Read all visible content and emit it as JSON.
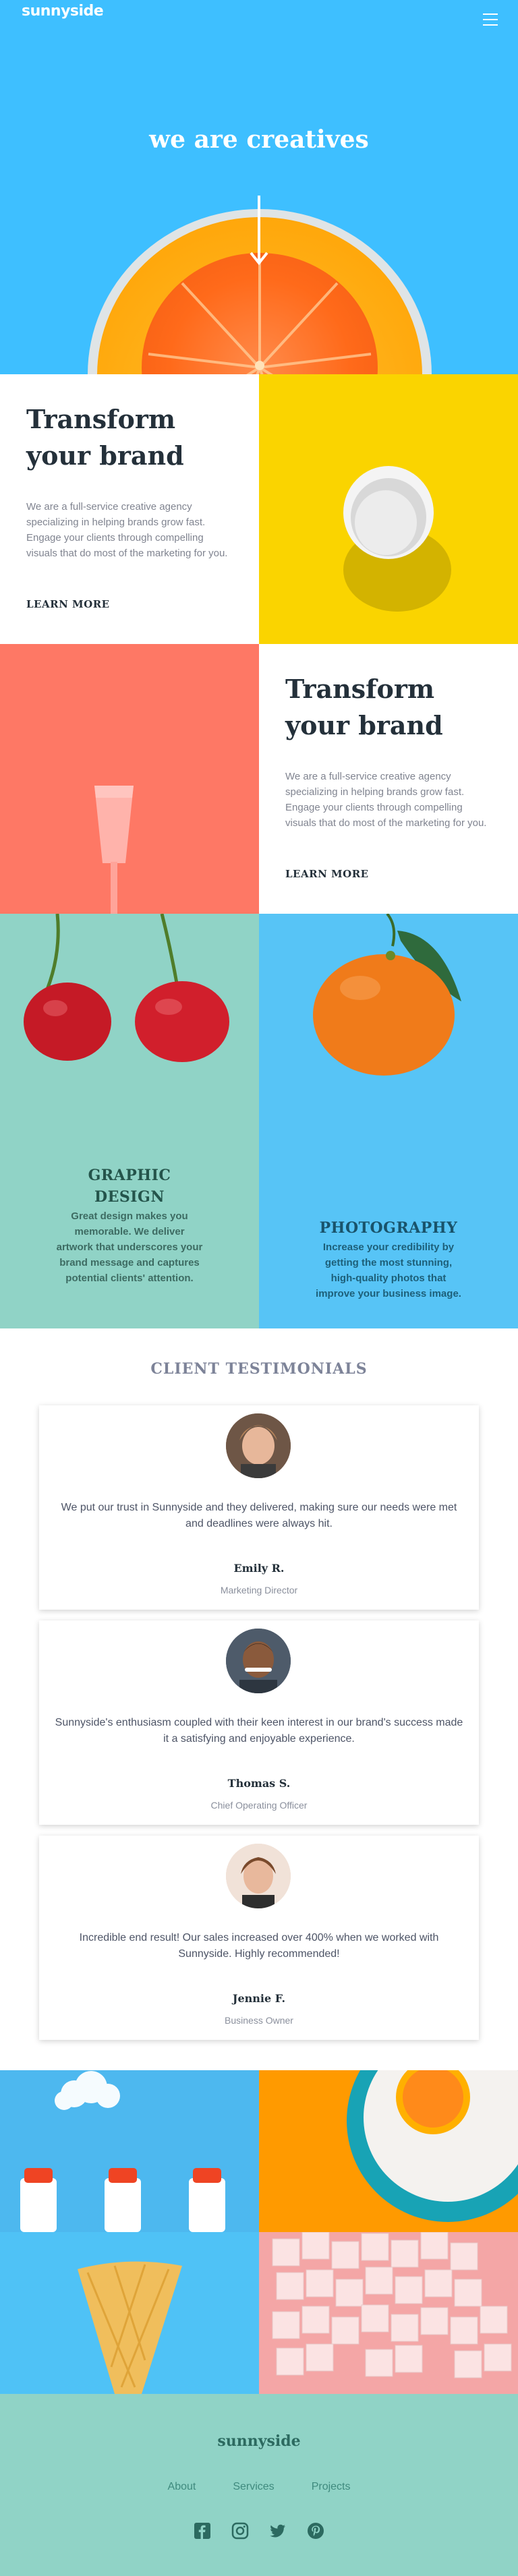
{
  "header": {
    "logo": "sunnyside",
    "menu_icon": "hamburger-menu-icon"
  },
  "hero": {
    "title": "we are creatives",
    "arrow_icon": "arrow-down-icon"
  },
  "features": [
    {
      "title": "Transform your brand",
      "body": "We are a full-service creative agency specializing in helping brands grow fast. Engage your clients through compelling visuals that do most of the marketing for you.",
      "cta": "LEARN MORE",
      "underline_color": "#fad400"
    },
    {
      "title": "Transform your brand",
      "body": "We are a full-service creative agency specializing in helping brands grow fast. Engage your clients through compelling visuals that do most of the marketing for you.",
      "cta": "LEARN MORE",
      "underline_color": "#fe7865"
    }
  ],
  "services": [
    {
      "title": "GRAPHIC DESIGN",
      "body": "Great design makes you memorable. We deliver artwork that underscores your brand message and captures potential clients' attention.",
      "color": "#24544b"
    },
    {
      "title": "PHOTOGRAPHY",
      "body": "Increase your credibility by getting the most stunning, high-quality photos that improve your business image.",
      "color": "#19536b"
    }
  ],
  "testimonials": {
    "heading": "CLIENT TESTIMONIALS",
    "items": [
      {
        "quote": "We put our trust in Sunnyside and they delivered, making sure our needs were met and deadlines were always hit.",
        "name": "Emily R.",
        "role": "Marketing Director"
      },
      {
        "quote": "Sunnyside's enthusiasm coupled with their keen interest in our brand's success made it a satisfying and enjoyable experience.",
        "name": "Thomas S.",
        "role": "Chief Operating Officer"
      },
      {
        "quote": "Incredible end result! Our sales increased over 400% when we worked with Sunnyside. Highly recommended!",
        "name": "Jennie F.",
        "role": "Business Owner"
      }
    ]
  },
  "footer": {
    "logo": "sunnyside",
    "nav": [
      "About",
      "Services",
      "Projects"
    ],
    "socials": [
      "facebook-icon",
      "instagram-icon",
      "twitter-icon",
      "pinterest-icon"
    ]
  },
  "colors": {
    "hero_bg": "#3ebfff",
    "yellow": "#fad400",
    "salmon": "#fe7865",
    "mint": "#90d3c6",
    "sky": "#57c4f6",
    "dark_text": "#24303a"
  }
}
